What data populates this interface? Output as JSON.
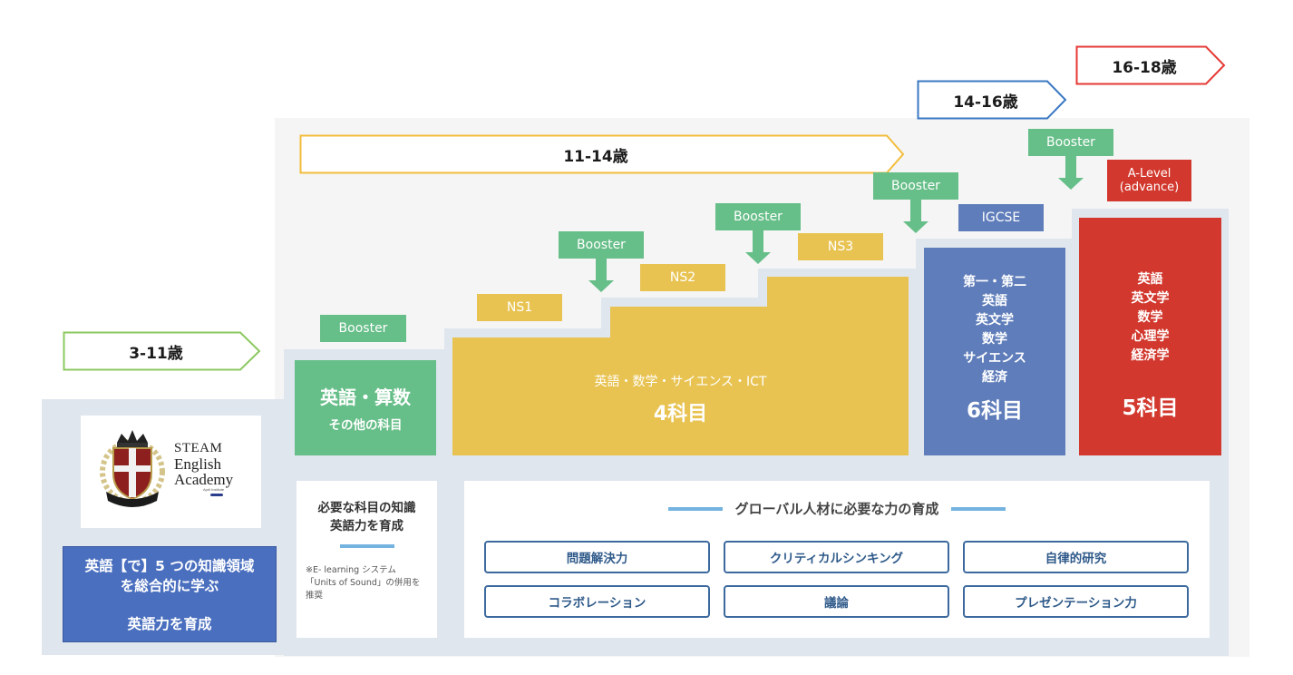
{
  "ages": [
    {
      "label": "3-11歳",
      "color": "#8cc860"
    },
    {
      "label": "11-14歳",
      "color": "#f2bd3c"
    },
    {
      "label": "14-16歳",
      "color": "#3a78c2"
    },
    {
      "label": "16-18歳",
      "color": "#e53935"
    }
  ],
  "logo": {
    "line1": "STEAM",
    "line2": "English",
    "line3": "Academy",
    "sub": "April Institute"
  },
  "left_panel": {
    "line1": "英語【で】5 つの知識領域",
    "line2": "を総合的に学ぶ",
    "line3": "英語力を育成"
  },
  "booster_label": "Booster",
  "levels": {
    "ns1": "NS1",
    "ns2": "NS2",
    "ns3": "NS3",
    "igcse": "IGCSE",
    "alevel_line1": "A-Level",
    "alevel_line2": "(advance)"
  },
  "blocks": {
    "green": {
      "title": "英語・算数",
      "sub": "その他の科目"
    },
    "yellow": {
      "subjects": "英語・数学・サイエンス・ICT",
      "count": "4科目"
    },
    "blue": {
      "subjects": [
        "第一・第二",
        "英語",
        "英文学",
        "数学",
        "サイエンス",
        "経済"
      ],
      "count": "6科目"
    },
    "red": {
      "subjects": [
        "英語",
        "英文学",
        "数学",
        "心理学",
        "経済学"
      ],
      "count": "5科目"
    }
  },
  "knowledge_box": {
    "title_line1": "必要な科目の知識",
    "title_line2": "英語力を育成",
    "note_line1": "※E- learning システム",
    "note_line2": "「Units of Sound」の併用を",
    "note_line3": "推奨"
  },
  "global_box": {
    "title": "グローバル人材に必要な力の育成",
    "skills": [
      "問題解決力",
      "クリティカルシンキング",
      "自律的研究",
      "コラボレーション",
      "議論",
      "プレゼンテーション力"
    ]
  }
}
